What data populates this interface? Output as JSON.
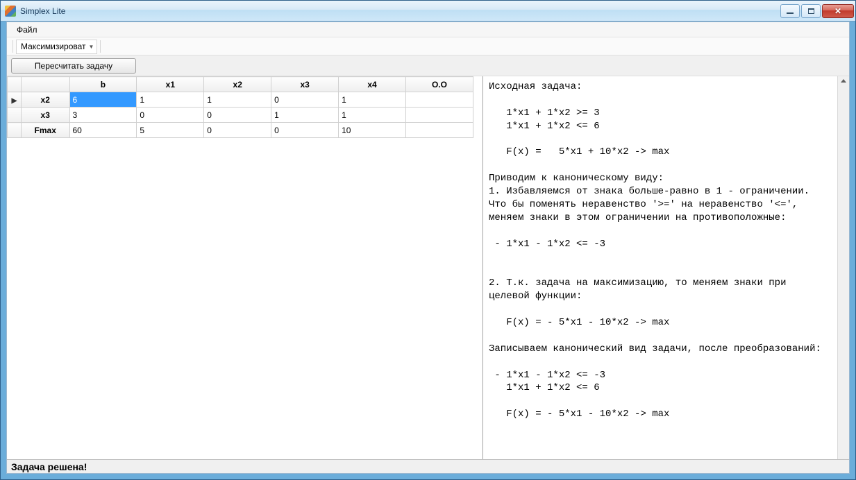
{
  "window": {
    "title": "Simplex Lite"
  },
  "menubar": {
    "file": "Файл"
  },
  "toolbar": {
    "optimize_mode": "Максимизироват",
    "recalc_label": "Пересчитать задачу"
  },
  "grid": {
    "headers": {
      "rowlead": "",
      "b": "b",
      "x1": "x1",
      "x2": "x2",
      "x3": "x3",
      "x4": "x4",
      "oo": "О.О"
    },
    "rows": [
      {
        "indicator": "▶",
        "name": "x2",
        "b": "6",
        "x1": "1",
        "x2": "1",
        "x3": "0",
        "x4": "1",
        "oo": ""
      },
      {
        "indicator": "",
        "name": "x3",
        "b": "3",
        "x1": "0",
        "x2": "0",
        "x3": "1",
        "x4": "1",
        "oo": ""
      },
      {
        "indicator": "",
        "name": "Fmax",
        "b": "60",
        "x1": "5",
        "x2": "0",
        "x3": "0",
        "x4": "10",
        "oo": ""
      }
    ],
    "selected": {
      "row": 0,
      "col": "b"
    }
  },
  "output_text": "Исходная задача:\n\n   1*x1 + 1*x2 >= 3\n   1*x1 + 1*x2 <= 6\n\n   F(x) =   5*x1 + 10*x2 -> max\n\nПриводим к каноническому виду:\n1. Избавляемся от знака больше-равно в 1 - ограничении. Что бы поменять неравенство '>=' на неравенство '<=', меняем знаки в этом ограничении на противоположные:\n\n - 1*x1 - 1*x2 <= -3\n\n\n2. Т.к. задача на максимизацию, то меняем знаки при целевой функции:\n\n   F(x) = - 5*x1 - 10*x2 -> max\n\nЗаписываем канонический вид задачи, после преобразований:\n\n - 1*x1 - 1*x2 <= -3\n   1*x1 + 1*x2 <= 6\n\n   F(x) = - 5*x1 - 10*x2 -> max\n",
  "statusbar": {
    "text": "Задача решена!"
  }
}
